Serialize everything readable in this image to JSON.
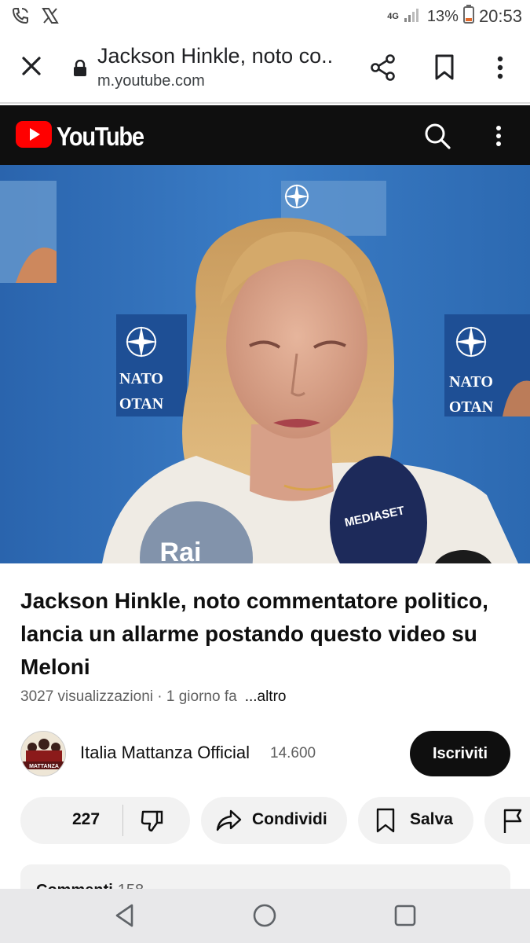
{
  "status_bar": {
    "network": "4G",
    "battery": "13%",
    "time": "20:53"
  },
  "browser": {
    "page_title": "Jackson Hinkle, noto co...",
    "domain": "m.youtube.com"
  },
  "youtube": {
    "logo_text": "YouTube",
    "brand_color": "#ff0000"
  },
  "video": {
    "frame_text": {
      "nato_left": "NATO",
      "otan_left": "OTAN",
      "nato_right": "NATO",
      "otan_right": "OTAN",
      "mic_left": "Rai",
      "mic_right": "MEDIASET"
    }
  },
  "info": {
    "title": "Jackson Hinkle, noto commentatore politico, lancia un allarme postando questo video su Meloni",
    "views": "3027 visualizzazioni",
    "separator": " · ",
    "age": "1 giorno fa",
    "more": "...altro"
  },
  "channel": {
    "name": "Italia Mattanza Official",
    "subscribers": "14.600",
    "subscribe_label": "Iscriviti",
    "avatar_text": "MATTANZA"
  },
  "actions": {
    "likes": "227",
    "share_label": "Condividi",
    "save_label": "Salva"
  },
  "comments": {
    "label": "Commenti",
    "count": "158"
  }
}
